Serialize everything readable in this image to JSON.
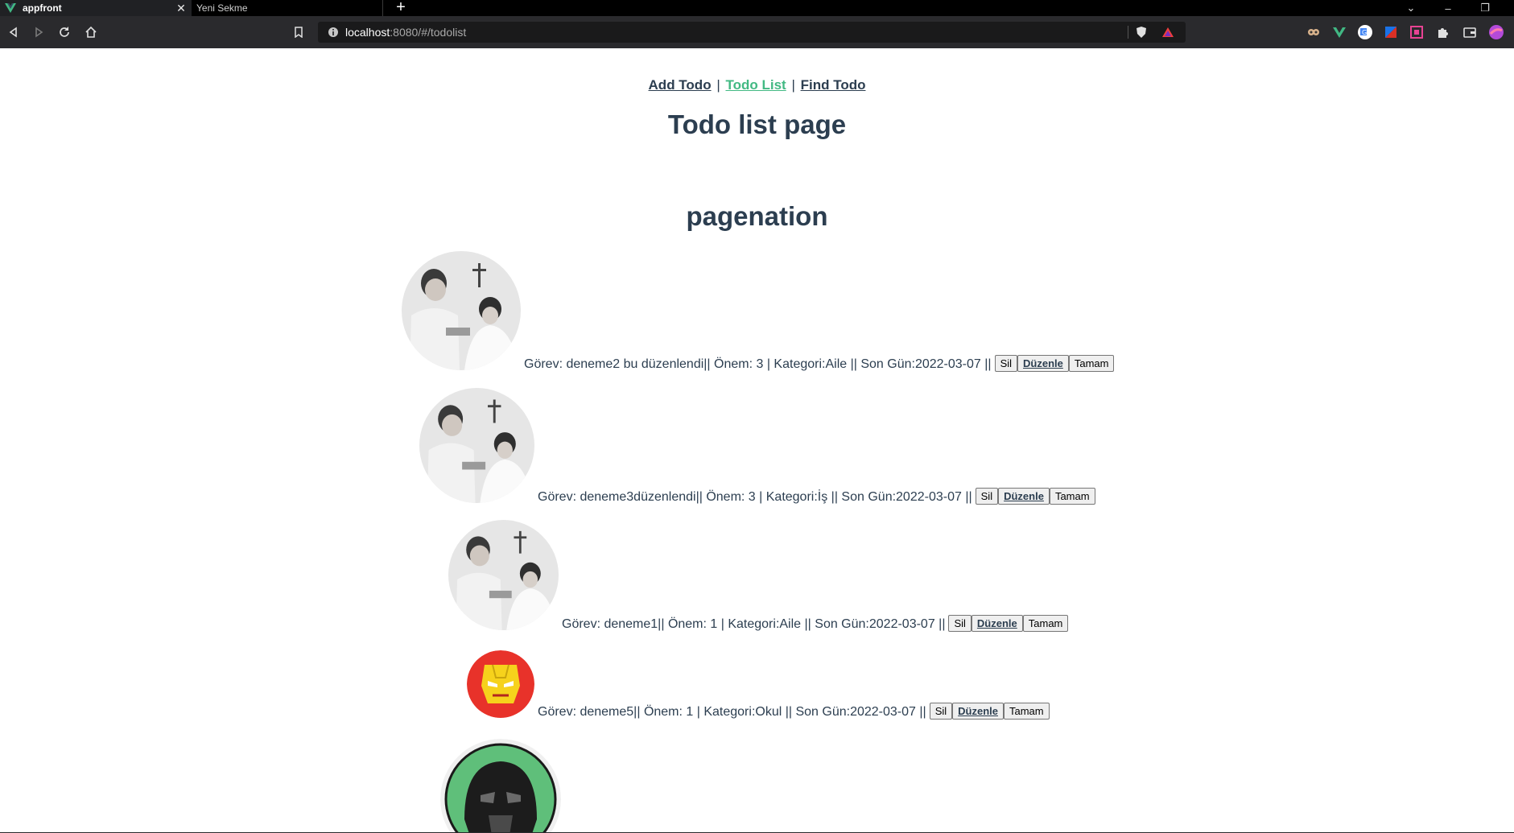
{
  "browser": {
    "tabs": [
      {
        "title": "appfront",
        "active": true
      },
      {
        "title": "Yeni Sekme",
        "active": false
      }
    ],
    "url_host": "localhost",
    "url_path": ":8080/#/todolist"
  },
  "nav": {
    "add_todo": "Add Todo",
    "separator": "|",
    "todo_list": "Todo List",
    "find_todo": "Find Todo"
  },
  "page": {
    "title": "Todo list page",
    "pagination_title": "pagenation"
  },
  "buttons": {
    "delete": "Sil",
    "edit": "Düzenle",
    "done": "Tamam"
  },
  "todos": [
    {
      "text": "Görev: deneme2 bu düzenlendi|| Önem: 3 | Kategori:Aile || Son Gün:2022-03-07 ||",
      "avatar": "photo"
    },
    {
      "text": "Görev: deneme3düzenlendi|| Önem: 3 | Kategori:İş || Son Gün:2022-03-07 ||",
      "avatar": "photo"
    },
    {
      "text": "Görev: deneme1|| Önem: 1 | Kategori:Aile || Son Gün:2022-03-07 ||",
      "avatar": "photo"
    },
    {
      "text": "Görev: deneme5|| Önem: 1 | Kategori:Okul || Son Gün:2022-03-07 ||",
      "avatar": "iron-man"
    },
    {
      "text": "",
      "avatar": "darth-vader"
    }
  ],
  "colors": {
    "text": "#2c3e50",
    "active_link": "#42b983"
  }
}
